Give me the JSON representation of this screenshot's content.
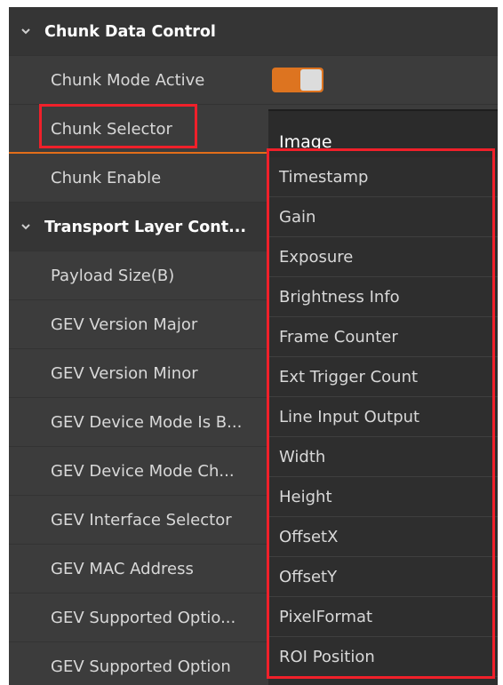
{
  "colors": {
    "panel_bg": "#3c3c3c",
    "accent_orange": "#e36e1a",
    "highlight_red": "#f0202a"
  },
  "tree": {
    "sections": [
      {
        "label": "Chunk Data Control"
      },
      {
        "label": "Transport Layer Cont..."
      }
    ],
    "chunk_mode_active": "Chunk Mode Active",
    "chunk_selector": "Chunk Selector",
    "chunk_enable": "Chunk Enable",
    "transport_items": [
      "Payload Size(B)",
      "GEV Version Major",
      "GEV Version Minor",
      "GEV Device Mode Is B...",
      "GEV Device Mode Ch...",
      "GEV Interface Selector",
      "GEV MAC Address",
      "GEV Supported Optio...",
      "GEV Supported Option"
    ]
  },
  "toggle": {
    "state": "on"
  },
  "dropdown": {
    "selected": "Image",
    "options": [
      "Timestamp",
      "Gain",
      "Exposure",
      "Brightness Info",
      "Frame Counter",
      "Ext Trigger Count",
      "Line Input Output",
      "Width",
      "Height",
      "OffsetX",
      "OffsetY",
      "PixelFormat",
      "ROI Position"
    ]
  }
}
